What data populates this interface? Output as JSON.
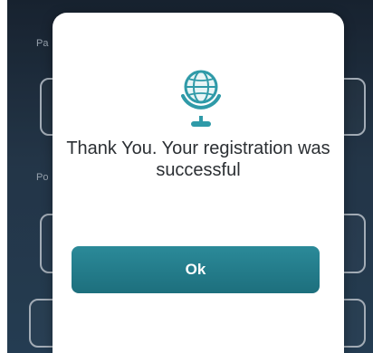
{
  "background_form": {
    "labels": [
      "Pa",
      "Po"
    ]
  },
  "dialog": {
    "icon": "globe-icon",
    "message": "Thank You. Your registration was successful",
    "ok_label": "Ok"
  },
  "colors": {
    "primary_button": "#237c8b",
    "icon_accent": "#2f9aa8",
    "background_dark": "#233447"
  }
}
